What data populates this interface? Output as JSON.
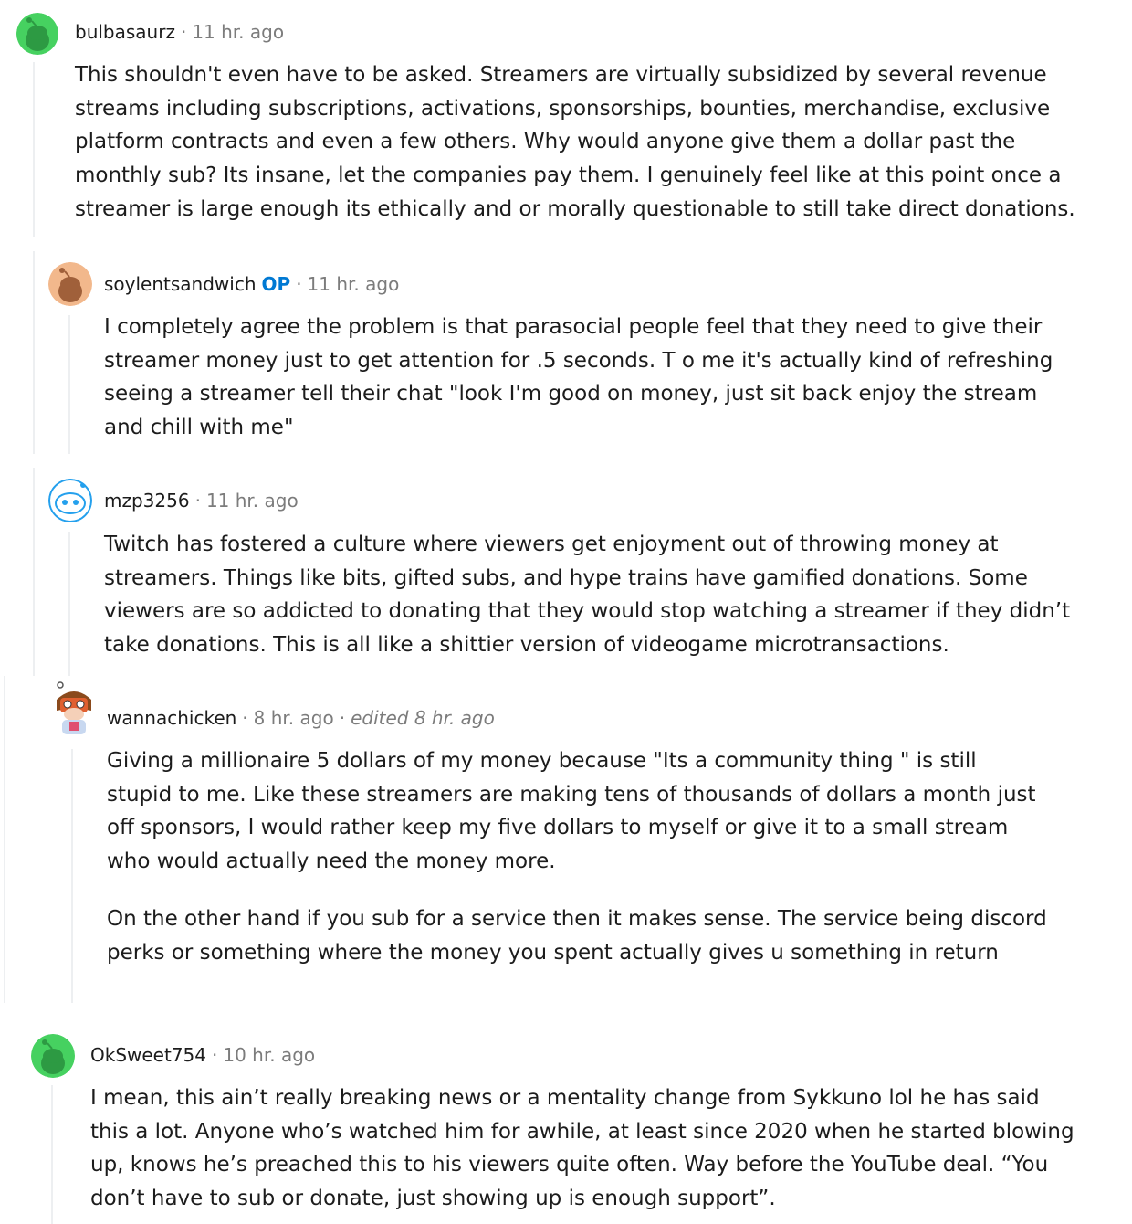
{
  "comments": [
    {
      "username": "bulbasaurz",
      "time": "11 hr. ago",
      "avatar_color": "#46d160",
      "paragraphs": [
        "This shouldn't even have to be asked. Streamers are virtually subsidized by several revenue streams including subscriptions, activations, sponsorships, bounties, merchandise, exclusive platform contracts and even a few others. Why would anyone give them a dollar past the monthly sub? Its insane, let the companies pay them. I genuinely feel like at this point once a streamer is large enough its ethically and or morally questionable to still take direct donations."
      ]
    },
    {
      "username": "soylentsandwich",
      "op_label": "OP",
      "time": "11 hr. ago",
      "avatar_color": "#f2b88c",
      "paragraphs": [
        "I completely agree the problem is that parasocial people feel that they need to give their streamer money just to get attention for .5 seconds. T o me it's actually kind of refreshing seeing a streamer tell their chat \"look I'm good on money, just sit back enjoy the stream and chill with me\""
      ]
    },
    {
      "username": "mzp3256",
      "time": "11 hr. ago",
      "avatar_color": "#24a0ed",
      "paragraphs": [
        "Twitch has fostered a culture where viewers get enjoyment out of throwing money at streamers. Things like bits, gifted subs, and hype trains have gamified donations. Some viewers are so addicted to donating that they would stop watching a streamer if they didn’t take donations. This is all like a shittier version of videogame microtransactions."
      ]
    },
    {
      "username": "wannachicken",
      "time": "8 hr. ago",
      "edited": "edited 8 hr. ago",
      "avatar_color": "#ffffff",
      "paragraphs": [
        "Giving a millionaire 5 dollars of my money because \"Its a community thing \" is still stupid to me. Like these streamers are making tens of thousands of dollars a month just off sponsors, I would rather keep my five dollars to myself or give it to a small stream who would actually need the money more.",
        "On the other hand if you sub for a service then it makes sense. The service being discord perks or something where the money you spent actually gives u something in return"
      ]
    },
    {
      "username": "OkSweet754",
      "time": "10 hr. ago",
      "avatar_color": "#46d160",
      "paragraphs": [
        "I mean, this ain’t really breaking news or a mentality change from Sykkuno lol he has said this a lot. Anyone who’s watched him for awhile, at least since 2020 when he started blowing up, knows he’s preached this to his viewers quite often. Way before the YouTube deal. “You don’t have to sub or donate, just showing up is enough support”."
      ]
    }
  ]
}
